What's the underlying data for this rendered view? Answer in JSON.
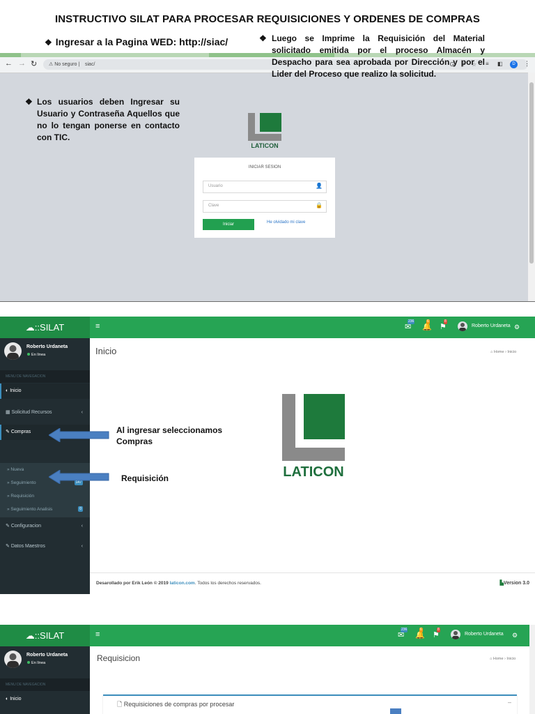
{
  "doc": {
    "title": "INSTRUCTIVO SILAT PARA PROCESAR REQUISICIONES Y ORDENES DE COMPRAS",
    "bullet1": "Ingresar a la Pagina WED: http://siac/",
    "bullet_symbol": "❖"
  },
  "browser": {
    "not_secure": "No seguro",
    "url": "siac/",
    "profile_initial": "D"
  },
  "login": {
    "brand": "LATICON",
    "heading": "INICIAR SESION",
    "username_placeholder": "Usuario",
    "password_placeholder": "Clave",
    "submit_label": "Iniciar",
    "forgot_link": "He olvidado mi clave",
    "instruction": "Los usuarios deben Ingresar su Usuario y Contraseña Aquellos que no lo tengan ponerse en contacto con TIC."
  },
  "app": {
    "logo_text": "::SILAT",
    "user_name": "Roberto Urdaneta",
    "status": "En línea",
    "menu_header": "MENU DE NAVEGACION",
    "badges": {
      "messages": "236",
      "notifications": "6",
      "flags": "8"
    },
    "menu": {
      "inicio": "Inicio",
      "solicitud": "Solicitud Recursos",
      "compras": "Compras",
      "nueva": "Nueva",
      "seguimiento": "Seguimiento",
      "seguimiento_count": "147",
      "requisicion": "Requisición",
      "seguimiento_analisis": "Seguimiento Analisis",
      "seguimiento_analisis_count": "0",
      "configuracion": "Configuracion",
      "datos_maestros": "Datos Maestros"
    },
    "page_title": "Inicio",
    "breadcrumb_home": "Home",
    "breadcrumb_current": "Inicio",
    "brand": "LATICON",
    "annotation_compras": "Al ingresar seleccionamos Compras",
    "annotation_requisicion": "Requisición",
    "footer_prefix": "Desarollado por Erik León © 2019",
    "footer_link": "laticon.com",
    "footer_suffix": ". Todos los derechos reservados.",
    "version": "Version 3.0"
  },
  "app3": {
    "page_title": "Requisicion",
    "instruction": "Luego se Imprime la Requisición del Material solicitado emitida por el proceso Almacén y Despacho para sea aprobada por Dirección y por el Lider del Proceso que realizo la solicitud.",
    "breadcrumb_home": "Home",
    "breadcrumb_current": "Inicio",
    "menu_inicio": "Inicio",
    "box_title": "Requisiciones de compras por procesar",
    "collapse": "–"
  }
}
